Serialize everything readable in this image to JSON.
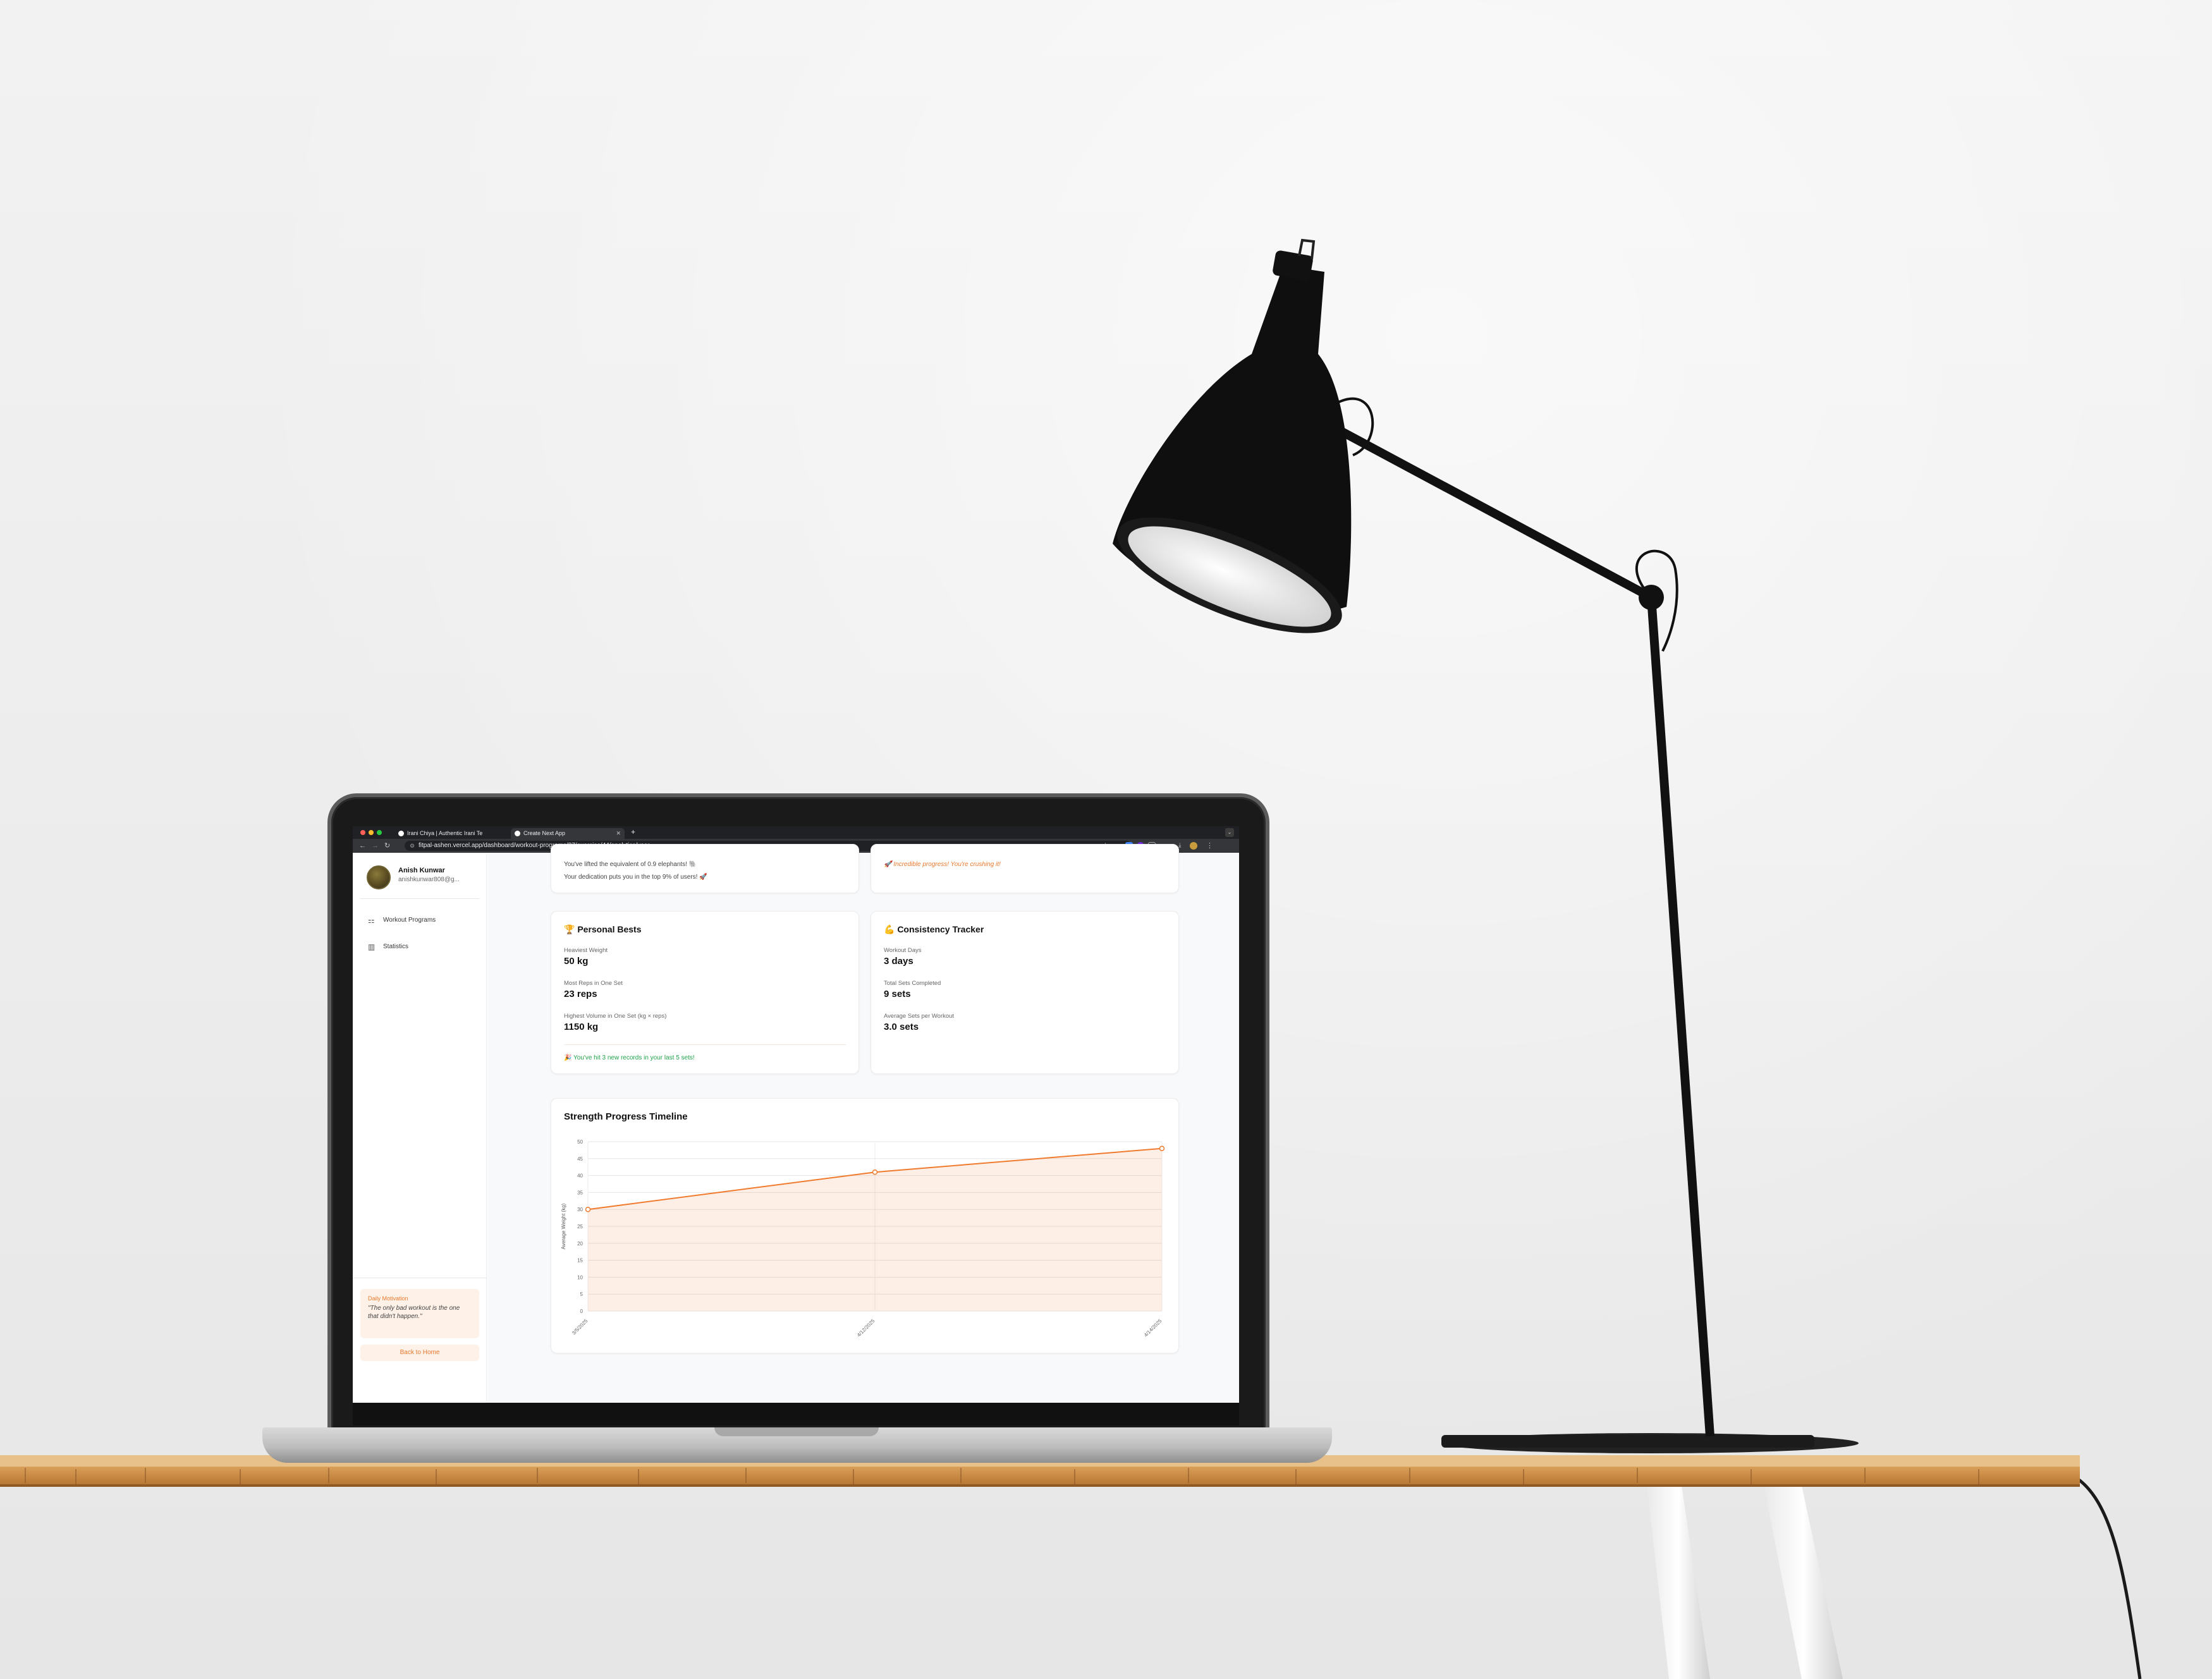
{
  "browser": {
    "tabs": [
      {
        "label": "Irani Chiya | Authentic Irani Te"
      },
      {
        "label": "Create Next App"
      }
    ],
    "new_tab": "+",
    "url": "fitpal-ashen.vercel.app/dashboard/workout-programs/37/exercise/44/analytics/year"
  },
  "user": {
    "name": "Anish Kunwar",
    "email": "anishkunwar808@g..."
  },
  "sidebar": {
    "items": [
      {
        "label": "Workout Programs",
        "icon": "dumbbell-icon"
      },
      {
        "label": "Statistics",
        "icon": "bar-chart-icon"
      }
    ],
    "motivation_title": "Daily Motivation",
    "motivation_quote": "\"The only bad workout is the one that didn't happen.\"",
    "back_label": "Back to Home"
  },
  "top_cards": {
    "left_line1": "You've lifted the equivalent of 0.9 elephants! 🐘",
    "left_line2": "Your dedication puts you in the top 9% of users! 🚀",
    "right_line": "🚀 Incredible progress! You're crushing it!"
  },
  "personal_bests": {
    "title": "🏆 Personal Bests",
    "stats": [
      {
        "label": "Heaviest Weight",
        "value": "50 kg"
      },
      {
        "label": "Most Reps in One Set",
        "value": "23 reps"
      },
      {
        "label": "Highest Volume in One Set (kg × reps)",
        "value": "1150 kg"
      }
    ],
    "note": "🎉 You've hit 3 new records in your last 5 sets!"
  },
  "consistency": {
    "title": "💪 Consistency Tracker",
    "stats": [
      {
        "label": "Workout Days",
        "value": "3 days"
      },
      {
        "label": "Total Sets Completed",
        "value": "9 sets"
      },
      {
        "label": "Average Sets per Workout",
        "value": "3.0 sets"
      }
    ]
  },
  "chart_data": {
    "type": "area",
    "title": "Strength Progress Timeline",
    "xlabel": "",
    "ylabel": "Average Weight (kg)",
    "ylim": [
      0,
      50
    ],
    "yticks": [
      0,
      5,
      10,
      15,
      20,
      25,
      30,
      35,
      40,
      45,
      50
    ],
    "x": [
      "3/5/2025",
      "4/12/2025",
      "4/14/2025"
    ],
    "values": [
      30,
      41,
      48
    ],
    "grid": true,
    "color": "#f07a2d"
  }
}
